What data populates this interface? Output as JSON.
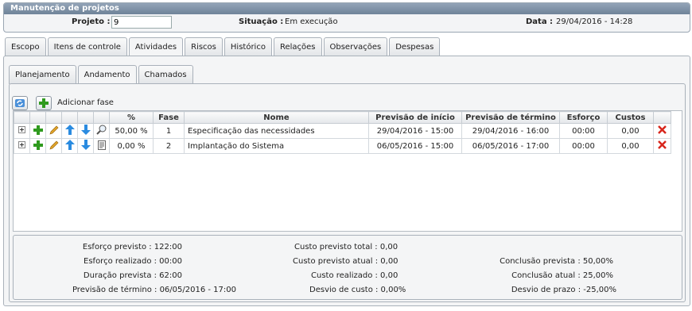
{
  "window_title": "Manutenção de projetos",
  "header": {
    "project_label": "Projeto :",
    "project_value": "9",
    "status_label": "Situação :",
    "status_value": "Em execução",
    "date_label": "Data :",
    "date_value": "29/04/2016 - 14:28"
  },
  "main_tabs": [
    "Escopo",
    "Itens de controle",
    "Atividades",
    "Riscos",
    "Histórico",
    "Relações",
    "Observações",
    "Despesas"
  ],
  "sub_tabs": [
    "Planejamento",
    "Andamento",
    "Chamados"
  ],
  "toolbar": {
    "add_phase_label": "Adicionar fase"
  },
  "table": {
    "columns": [
      "%",
      "Fase",
      "Nome",
      "Previsão de início",
      "Previsão de término",
      "Esforço",
      "Custos"
    ],
    "rows": [
      {
        "percent": "50,00 %",
        "phase": "1",
        "name": "Especificação das necessidades",
        "start": "29/04/2016 - 15:00",
        "end": "29/04/2016 - 16:00",
        "effort": "00:00",
        "cost": "0,00"
      },
      {
        "percent": "0,00 %",
        "phase": "2",
        "name": "Implantação do Sistema",
        "start": "06/05/2016 - 15:00",
        "end": "06/05/2016 - 17:00",
        "effort": "00:00",
        "cost": "0,00"
      }
    ]
  },
  "summary": {
    "effort_planned": "Esforço previsto : 122:00",
    "effort_done": "Esforço realizado : 00:00",
    "duration_planned": "Duração prevista : 62:00",
    "end_planned": "Previsão de término : 06/05/2016 - 17:00",
    "cost_total_planned": "Custo previsto total : 0,00",
    "cost_current_planned": "Custo previsto atual : 0,00",
    "cost_done": "Custo realizado : 0,00",
    "cost_deviation": "Desvio de custo : 0,00%",
    "completion_planned": "Conclusão prevista : 50,00%",
    "completion_current": "Conclusão atual : 25,00%",
    "deadline_deviation": "Desvio de prazo : -25,00%"
  },
  "colors": {
    "plus": "#2f9a1e",
    "arrow": "#2a8be0",
    "delete": "#d8261c",
    "pencil": "#e0a52a"
  }
}
